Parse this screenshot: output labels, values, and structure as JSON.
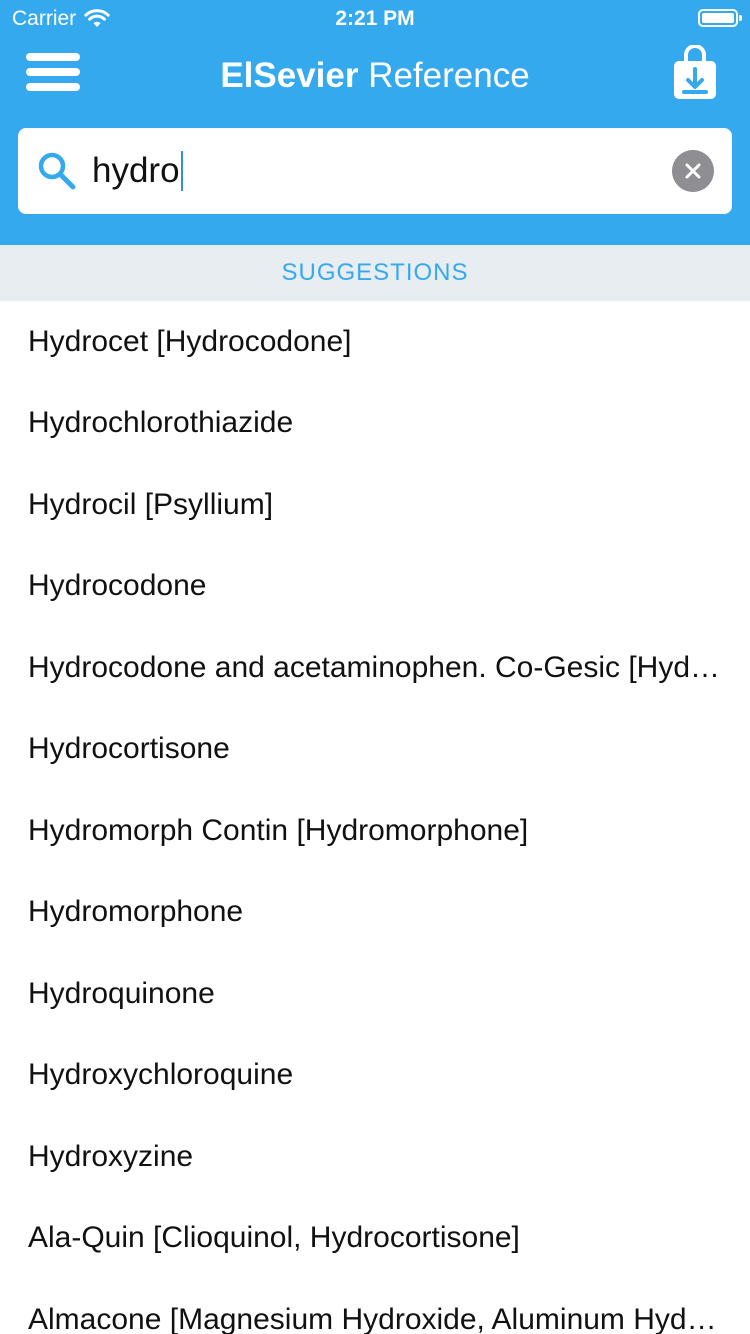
{
  "status_bar": {
    "carrier": "Carrier",
    "time": "2:21 PM",
    "wifi_icon": "wifi-icon",
    "battery_icon": "battery-icon",
    "battery_level": 1.0
  },
  "nav": {
    "title_brand": "ElSevier",
    "title_rest": " Reference",
    "menu_icon": "hamburger-menu-icon",
    "download_icon": "download-bag-icon"
  },
  "search": {
    "value": "hydro",
    "search_icon": "search-icon",
    "clear_icon": "clear-icon"
  },
  "suggestions": {
    "header": "SUGGESTIONS",
    "items": [
      "Hydrocet [Hydrocodone]",
      "Hydrochlorothiazide",
      "Hydrocil [Psyllium]",
      "Hydrocodone",
      "Hydrocodone and acetaminophen. Co-Gesic [Hydrocodone and acetaminophen]",
      "Hydrocortisone",
      "Hydromorph Contin [Hydromorphone]",
      "Hydromorphone",
      "Hydroquinone",
      "Hydroxychloroquine",
      "Hydroxyzine",
      "Ala-Quin [Clioquinol, Hydrocortisone]",
      "Almacone [Magnesium Hydroxide, Aluminum Hydroxide]"
    ]
  },
  "colors": {
    "primary": "#35A9EE",
    "section_header_bg": "#E8EDF1",
    "clear_button": "#8E8E93",
    "caret": "#2F8FE6"
  }
}
